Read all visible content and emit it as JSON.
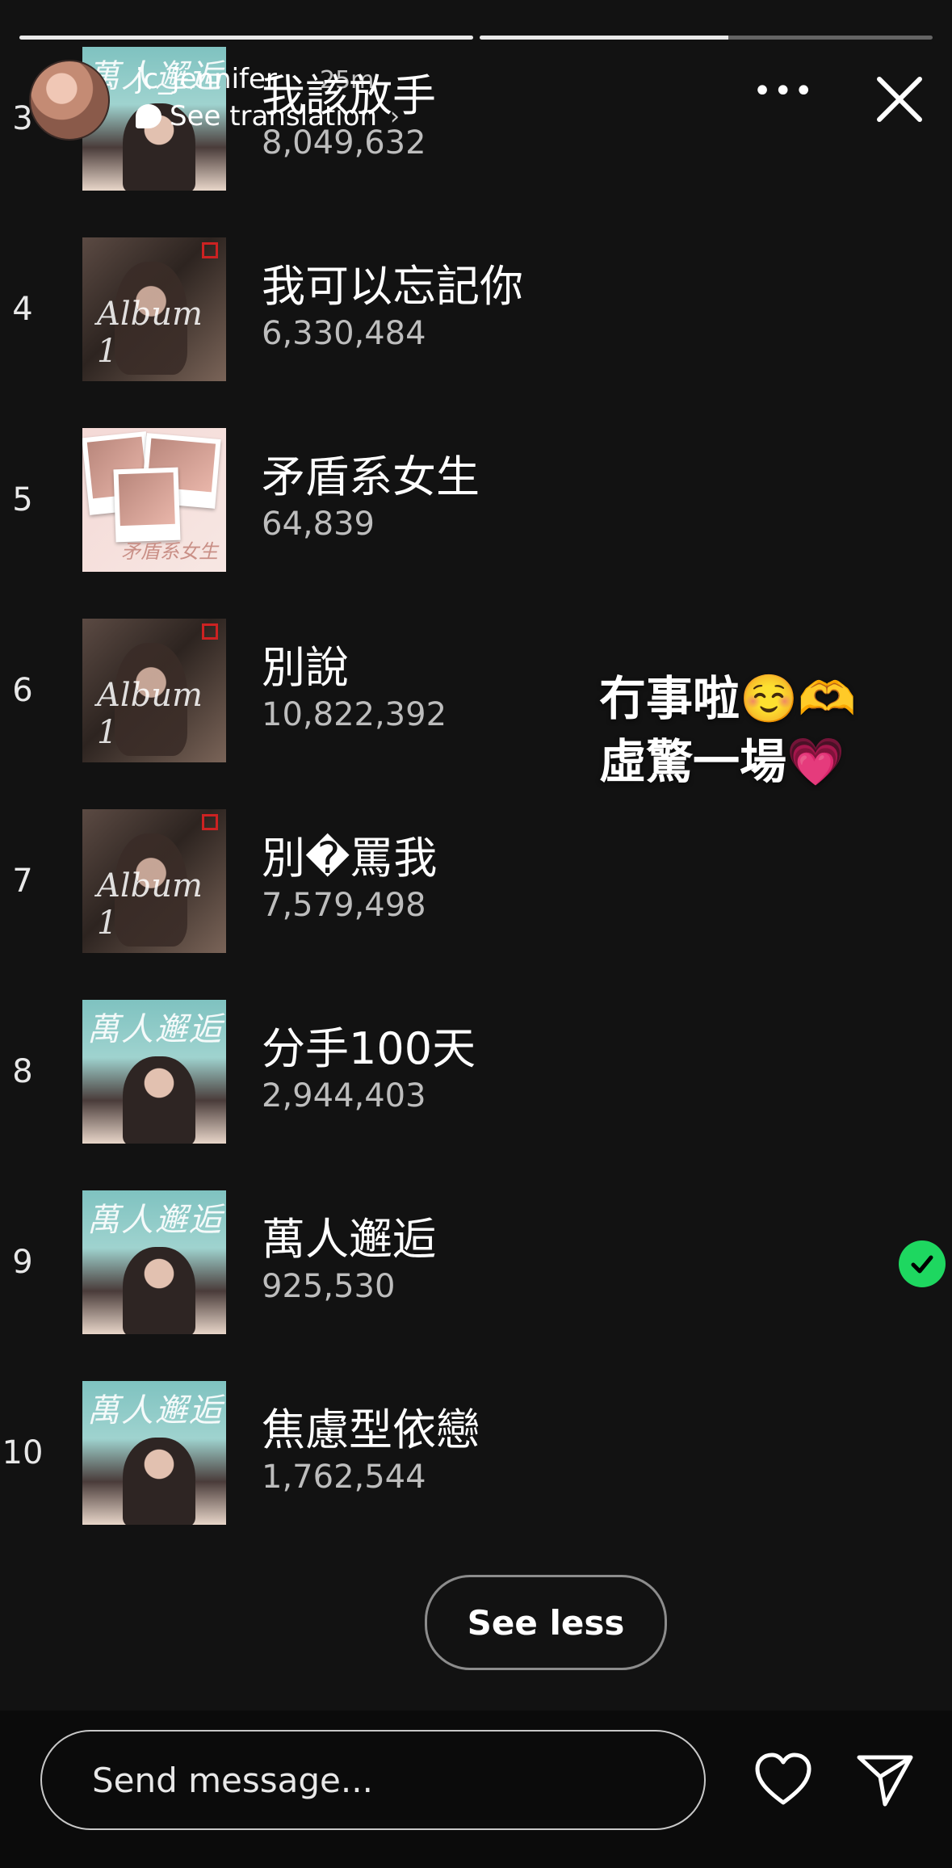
{
  "story": {
    "progress": [
      1.0,
      0.55
    ],
    "user": {
      "username": "jc_jennifer",
      "time": "25m",
      "see_translation": "See translation"
    }
  },
  "tracks": [
    {
      "rank": "3",
      "title": "我該放手",
      "plays": "8,049,632",
      "cover": "ten-thousand",
      "saved": false
    },
    {
      "rank": "4",
      "title": "我可以忘記你",
      "plays": "6,330,484",
      "cover": "album-1",
      "saved": false
    },
    {
      "rank": "5",
      "title": "矛盾系女生",
      "plays": "64,839",
      "cover": "polaroid",
      "saved": false
    },
    {
      "rank": "6",
      "title": "別說",
      "plays": "10,822,392",
      "cover": "album-1",
      "saved": false
    },
    {
      "rank": "7",
      "title": "別�罵我",
      "plays": "7,579,498",
      "cover": "album-1",
      "saved": false
    },
    {
      "rank": "8",
      "title": "分手100天",
      "plays": "2,944,403",
      "cover": "ten-thousand",
      "saved": false
    },
    {
      "rank": "9",
      "title": "萬人邂逅",
      "plays": "925,530",
      "cover": "ten-thousand",
      "saved": true
    },
    {
      "rank": "10",
      "title": "焦慮型依戀",
      "plays": "1,762,544",
      "cover": "ten-thousand",
      "saved": false
    }
  ],
  "covers": {
    "album_1_text": "Album 1",
    "ten_thousand_text": "萬人邂逅",
    "polaroid_text": "矛盾系女生"
  },
  "overlay": {
    "line1": "冇事啦☺️🫶",
    "line2": "虛驚一場💗"
  },
  "see_less_label": "See less",
  "footer": {
    "message_placeholder": "Send message..."
  },
  "colors": {
    "background": "#121212",
    "accent_green": "#1ed760"
  }
}
